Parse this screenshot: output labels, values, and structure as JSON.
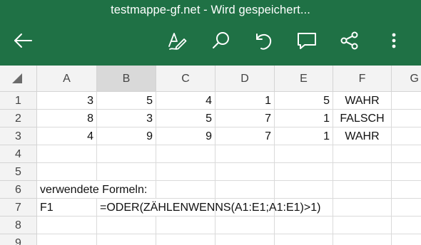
{
  "app": {
    "title": "testmappe-gf.net - Wird gespeichert...",
    "accent_color": "#1f7145",
    "toolbar_icons": [
      "back-arrow-icon",
      "draw-pen-icon",
      "search-icon",
      "undo-icon",
      "comment-icon",
      "share-icon",
      "more-vert-icon"
    ]
  },
  "sheet": {
    "columns": [
      "A",
      "B",
      "C",
      "D",
      "E",
      "F",
      "G"
    ],
    "selected_column": "B",
    "rows": [
      "1",
      "2",
      "3",
      "4",
      "5",
      "6",
      "7",
      "8",
      "9"
    ],
    "cells": {
      "r1": [
        "3",
        "5",
        "4",
        "1",
        "5",
        "WAHR"
      ],
      "r2": [
        "8",
        "3",
        "5",
        "7",
        "1",
        "FALSCH"
      ],
      "r3": [
        "4",
        "9",
        "9",
        "7",
        "1",
        "WAHR"
      ],
      "r6": {
        "a": "verwendete Formeln:"
      },
      "r7": {
        "a": "F1",
        "b": "=ODER(ZÄHLENWENNS(A1:E1;A1:E1)>1)"
      }
    }
  }
}
